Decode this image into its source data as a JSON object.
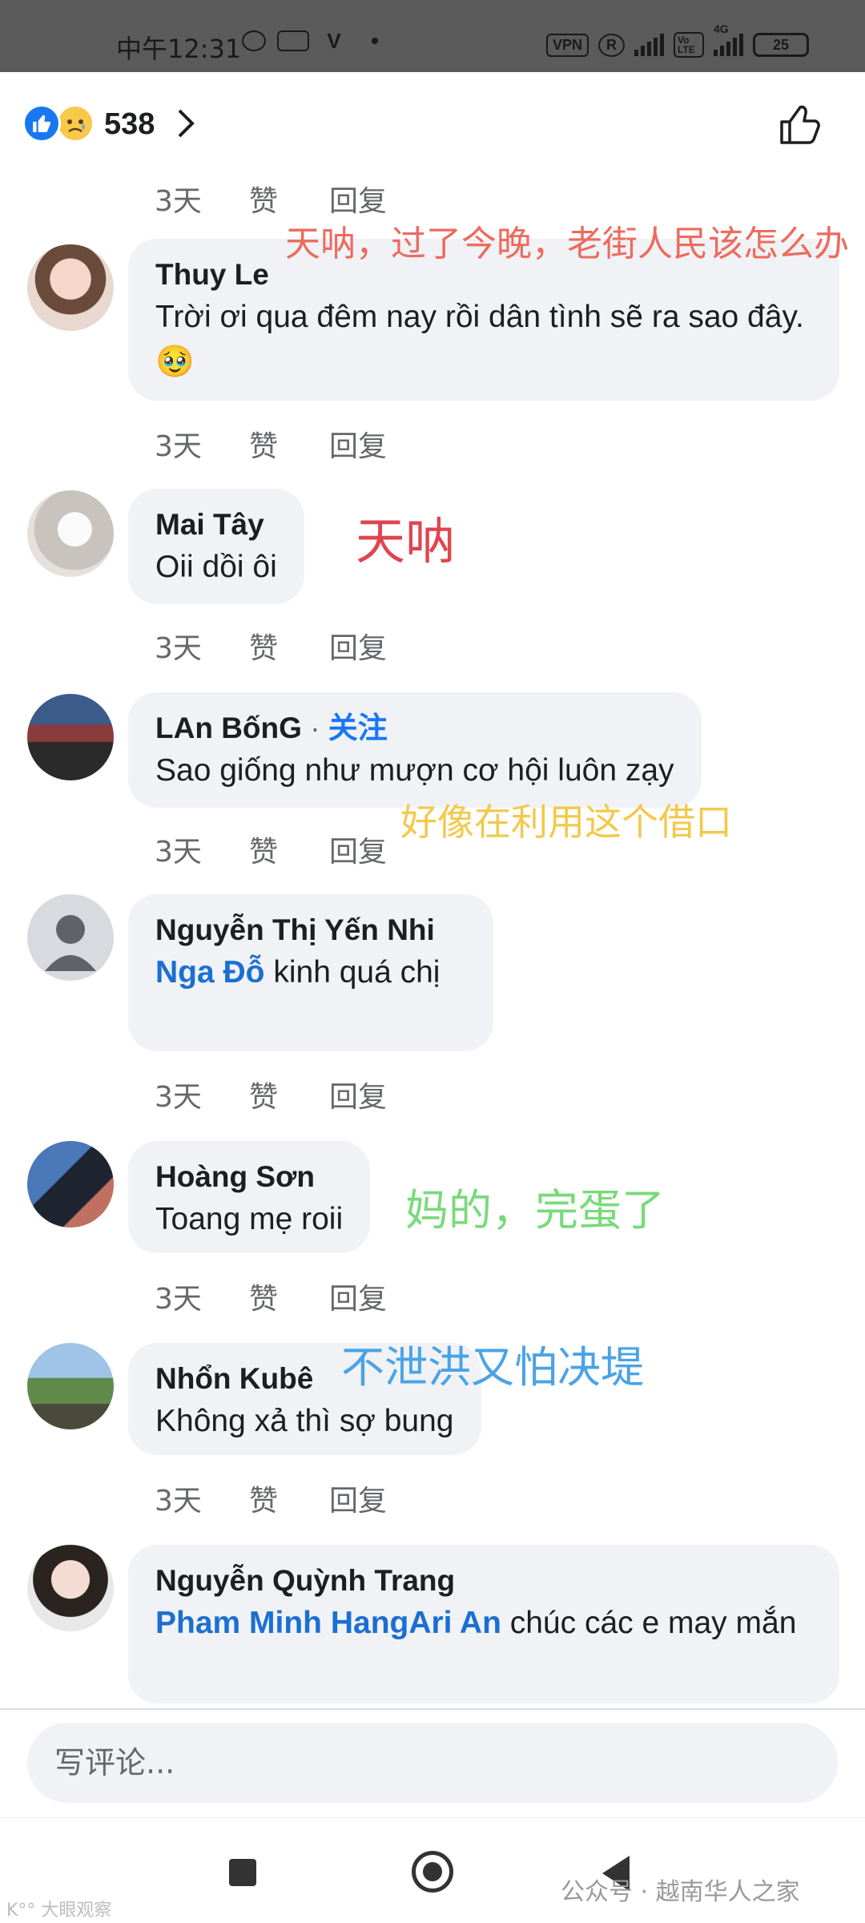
{
  "status_bar": {
    "time": "中午12:31",
    "vpn": "VPN",
    "r": "R",
    "volte": "Vo LTE",
    "network": "4G",
    "battery": "25"
  },
  "header": {
    "reaction_count": "538",
    "reactions": [
      "like-icon",
      "sad-icon"
    ]
  },
  "actions": {
    "like": "赞",
    "reply": "回复"
  },
  "comments": [
    {
      "time": "3天"
    },
    {
      "name": "Thuy Le",
      "text": "Trời ơi qua đêm nay rồi dân tình sẽ ra sao đây.🥹",
      "time": "3天",
      "annotation": "天呐，过了今晚，老街人民该怎么办"
    },
    {
      "name": "Mai Tây",
      "text": "Oii dồi ôi",
      "time": "3天",
      "annotation": "天呐"
    },
    {
      "name": "LAn BốnG",
      "follow": "关注",
      "text": "Sao giống như mượn cơ hội luôn zạy",
      "time": "3天",
      "annotation": "好像在利用这个借口"
    },
    {
      "name": "Nguyễn Thị Yến Nhi",
      "mention": "Nga Đỗ",
      "text": " kinh quá chị",
      "time": "3天"
    },
    {
      "name": "Hoàng Sơn",
      "text": "Toang mẹ roii",
      "time": "3天",
      "annotation": "妈的，完蛋了"
    },
    {
      "name": "Nhổn Kubê",
      "text": "Không xả thì sợ bung",
      "time": "3天",
      "annotation": "不泄洪又怕决堤"
    },
    {
      "name": "Nguyễn Quỳnh Trang",
      "mention": "Pham Minh HangAri An",
      "text": " chúc các e may mắn"
    }
  ],
  "annotation_colors": {
    "comment_1": "#ec6b5e",
    "comment_2": "#e0454f",
    "comment_3": "#f2c94c",
    "comment_5": "#7bd97b",
    "comment_6": "#4aa3e6"
  },
  "composer": {
    "placeholder": "写评论..."
  },
  "watermark": "公众号 · 越南华人之家"
}
